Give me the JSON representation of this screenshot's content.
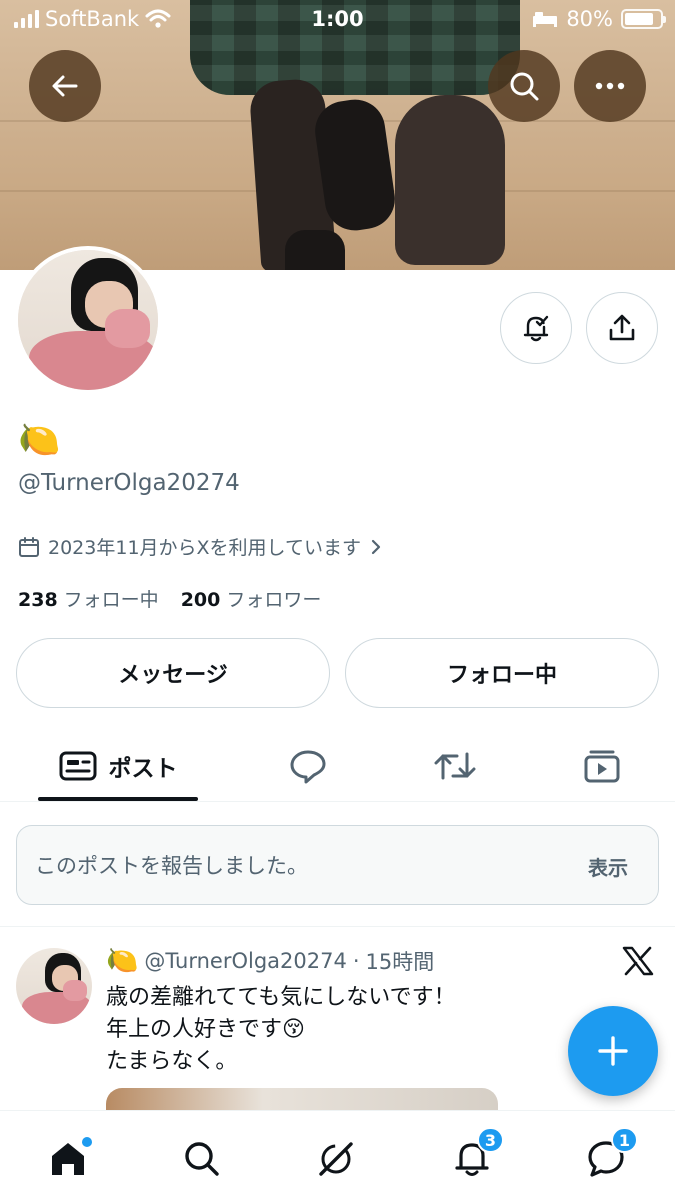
{
  "status_bar": {
    "carrier": "SoftBank",
    "time": "1:00",
    "battery_percent": "80%",
    "battery_level": 0.8
  },
  "header": {
    "back_icon": "arrow-left-icon",
    "search_icon": "search-icon",
    "more_icon": "more-horizontal-icon"
  },
  "profile": {
    "display_name": "🍋",
    "handle": "@TurnerOlga20274",
    "joined": "2023年11月からXを利用しています",
    "following_count": "238",
    "following_label": "フォロー中",
    "followers_count": "200",
    "followers_label": "フォロワー"
  },
  "actions": {
    "message_label": "メッセージ",
    "following_label": "フォロー中"
  },
  "tabs": {
    "posts_label": "ポスト",
    "active": "posts"
  },
  "report": {
    "message": "このポストを報告しました。",
    "show_label": "表示"
  },
  "post": {
    "author_emoji": "🍋",
    "handle": "@TurnerOlga20274",
    "separator": "·",
    "time": "15時間",
    "line1": "歳の差離れてても気にしないです！",
    "line2": "年上の人好きです😚",
    "line3": "たまらなく。"
  },
  "bottom_nav": {
    "notifications_badge": "3",
    "messages_badge": "1"
  },
  "colors": {
    "accent": "#1d9bf0",
    "text_primary": "#0f1419",
    "text_secondary": "#536471",
    "border": "#cfd9de"
  }
}
